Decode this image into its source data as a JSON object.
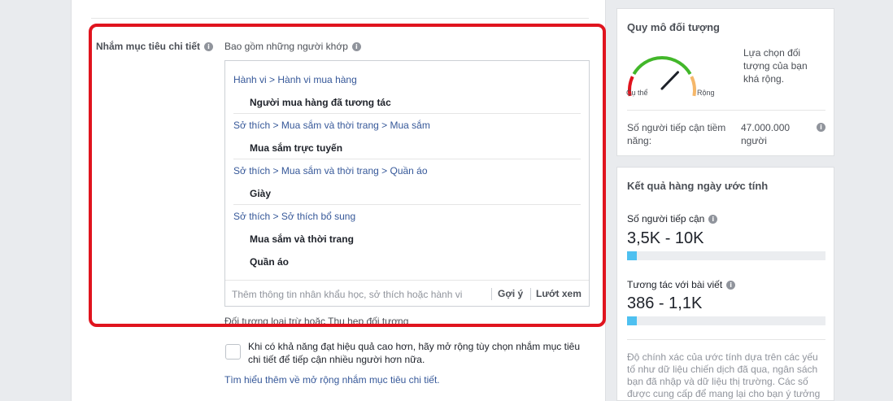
{
  "targeting": {
    "label": "Nhắm mục tiêu chi tiết",
    "include_label": "Bao gồm những người khớp",
    "groups": [
      {
        "category": "Hành vi > Hành vi mua hàng",
        "items": [
          "Người mua hàng đã tương tác"
        ]
      },
      {
        "category": "Sở thích > Mua sắm và thời trang > Mua sắm",
        "items": [
          "Mua sắm trực tuyến"
        ]
      },
      {
        "category": "Sở thích > Mua sắm và thời trang > Quần áo",
        "items": [
          "Giày"
        ]
      },
      {
        "category": "Sở thích > Sở thích bổ sung",
        "items": [
          "Mua sắm và thời trang",
          "Quần áo"
        ]
      }
    ],
    "input_placeholder": "Thêm thông tin nhân khẩu học, sở thích hoặc hành vi",
    "suggest_label": "Gợi ý",
    "browse_label": "Lướt xem",
    "exclude_link": "Đối tượng loại trừ hoặc Thu hẹp đối tượng",
    "expand_text": "Khi có khả năng đạt hiệu quả cao hơn, hãy mở rộng tùy chọn nhắm mục tiêu chi tiết để tiếp cận nhiều người hơn nữa.",
    "learn_more": "Tìm hiểu thêm về mở rộng nhắm mục tiêu chi tiết."
  },
  "audience_size": {
    "title": "Quy mô đối tượng",
    "gauge_left": "Cụ thể",
    "gauge_right": "Rộng",
    "gauge_level": 0.72,
    "description": "Lựa chọn đối tượng của bạn khá rộng.",
    "potential_reach_label": "Số người tiếp cận tiềm năng:",
    "potential_reach_value": "47.000.000 người"
  },
  "daily_results": {
    "title": "Kết quả hàng ngày ước tính",
    "reach_label": "Số người tiếp cận",
    "reach_value": "3,5K - 10K",
    "reach_fill": 0.05,
    "engagement_label": "Tương tác với bài viết",
    "engagement_value": "386 - 1,1K",
    "engagement_fill": 0.05,
    "accuracy_note": "Độ chính xác của ước tính dựa trên các yếu tố như dữ liệu chiến dịch đã qua, ngân sách bạn đã nhập và dữ liệu thị trường. Các số được cung cấp để mang lại cho bạn ý tưởng"
  },
  "colors": {
    "highlight": "#e0141e",
    "link": "#365899",
    "bar_fill": "#4ec0f0",
    "gauge_red": "#e0141e",
    "gauge_green": "#42b72a",
    "gauge_orange": "#f5b76a"
  },
  "icons": {
    "info": "info-icon",
    "gauge": "gauge-icon"
  }
}
